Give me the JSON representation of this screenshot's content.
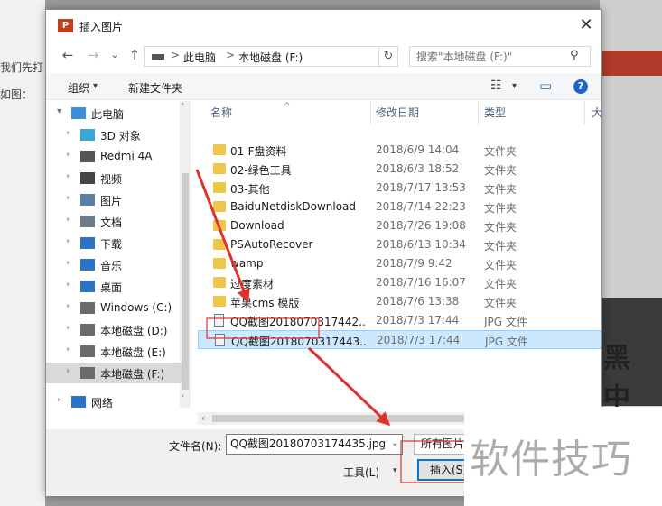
{
  "background": {
    "left_text": [
      "我们先打",
      "如图："
    ],
    "right_word": "黑 中"
  },
  "dialog": {
    "title": "插入图片",
    "app_icon_label": "P",
    "close_glyph": "✕"
  },
  "navbar": {
    "back_glyph": "←",
    "forward_glyph": "→",
    "dropdown_glyph": "⌄",
    "up_glyph": "↑",
    "path": [
      "此电脑",
      "本地磁盘 (F:)"
    ],
    "path_sep": ">",
    "path_dropdown_glyph": "⌄",
    "refresh_glyph": "↻",
    "search_placeholder": "搜索\"本地磁盘 (F:)\"",
    "search_glyph": "⚲"
  },
  "toolbar": {
    "organize": "组织",
    "organize_arrow": "▾",
    "new_folder": "新建文件夹",
    "view_glyph": "☷",
    "view_arrow": "▾",
    "preview_glyph": "▭",
    "help_glyph": "?"
  },
  "nav_tree": {
    "items": [
      {
        "label": "此电脑",
        "icon": "pc-icon",
        "color": "#3a8fd8",
        "arrow": "▾"
      },
      {
        "label": "3D 对象",
        "icon": "3d-objects-icon",
        "color": "#3aa7d8",
        "arrow": "›"
      },
      {
        "label": "Redmi 4A",
        "icon": "phone-icon",
        "color": "#555555",
        "arrow": "›"
      },
      {
        "label": "视频",
        "icon": "video-icon",
        "color": "#444444",
        "arrow": "›"
      },
      {
        "label": "图片",
        "icon": "pictures-icon",
        "color": "#5a7ea6",
        "arrow": "›"
      },
      {
        "label": "文档",
        "icon": "documents-icon",
        "color": "#6b7b8c",
        "arrow": "›"
      },
      {
        "label": "下载",
        "icon": "downloads-icon",
        "color": "#2a73c9",
        "arrow": "›"
      },
      {
        "label": "音乐",
        "icon": "music-icon",
        "color": "#2a73c9",
        "arrow": "›"
      },
      {
        "label": "桌面",
        "icon": "desktop-icon",
        "color": "#2a73c9",
        "arrow": "›"
      },
      {
        "label": "Windows (C:)",
        "icon": "windows-drive-icon",
        "color": "#6b6b6b",
        "arrow": "›"
      },
      {
        "label": "本地磁盘 (D:)",
        "icon": "drive-icon",
        "color": "#6b6b6b",
        "arrow": "›"
      },
      {
        "label": "本地磁盘 (E:)",
        "icon": "drive-icon",
        "color": "#6b6b6b",
        "arrow": "›"
      },
      {
        "label": "本地磁盘 (F:)",
        "icon": "drive-icon",
        "color": "#6b6b6b",
        "arrow": "›",
        "selected": true
      },
      {
        "label": "网络",
        "icon": "network-icon",
        "color": "#2a73c9",
        "arrow": "›"
      }
    ]
  },
  "file_list": {
    "columns": [
      "名称",
      "修改日期",
      "类型",
      "大"
    ],
    "sort_glyph": "^",
    "rows": [
      {
        "name": "01-F盘资料",
        "date": "2018/6/9 14:04",
        "type": "文件夹",
        "kind": "folder"
      },
      {
        "name": "02-绿色工具",
        "date": "2018/6/3 18:52",
        "type": "文件夹",
        "kind": "folder"
      },
      {
        "name": "03-其他",
        "date": "2018/7/17 13:53",
        "type": "文件夹",
        "kind": "folder"
      },
      {
        "name": "BaiduNetdiskDownload",
        "date": "2018/7/14 22:23",
        "type": "文件夹",
        "kind": "folder"
      },
      {
        "name": "Download",
        "date": "2018/7/26 19:08",
        "type": "文件夹",
        "kind": "folder"
      },
      {
        "name": "PSAutoRecover",
        "date": "2018/6/13 10:34",
        "type": "文件夹",
        "kind": "folder"
      },
      {
        "name": "wamp",
        "date": "2018/7/9 9:42",
        "type": "文件夹",
        "kind": "folder"
      },
      {
        "name": "过度素材",
        "date": "2018/7/16 16:07",
        "type": "文件夹",
        "kind": "folder"
      },
      {
        "name": "苹果cms 模版",
        "date": "2018/7/6 13:38",
        "type": "文件夹",
        "kind": "folder"
      },
      {
        "name": "QQ截图2018070317442...",
        "date": "2018/7/3 17:44",
        "type": "JPG 文件",
        "kind": "jpg"
      },
      {
        "name": "QQ截图2018070317443...",
        "date": "2018/7/3 17:44",
        "type": "JPG 文件",
        "kind": "jpg",
        "selected": true
      }
    ],
    "scroll_left_glyph": "‹",
    "scroll_up_glyph": "˄",
    "scroll_down_glyph": "˅"
  },
  "bottom": {
    "filename_label": "文件名(N):",
    "filename_value": "QQ截图20180703174435.jpg",
    "filename_drop_glyph": "⌄",
    "file_type": "所有图片",
    "tools_label": "工具(L)",
    "tools_arrow": "▾",
    "insert_label": "插入(S)"
  },
  "watermark": {
    "text": "软件技巧"
  },
  "colors": {
    "annotation_red": "#e0312a",
    "selection_blue": "#cce8ff",
    "accent_blue": "#0078d7"
  }
}
